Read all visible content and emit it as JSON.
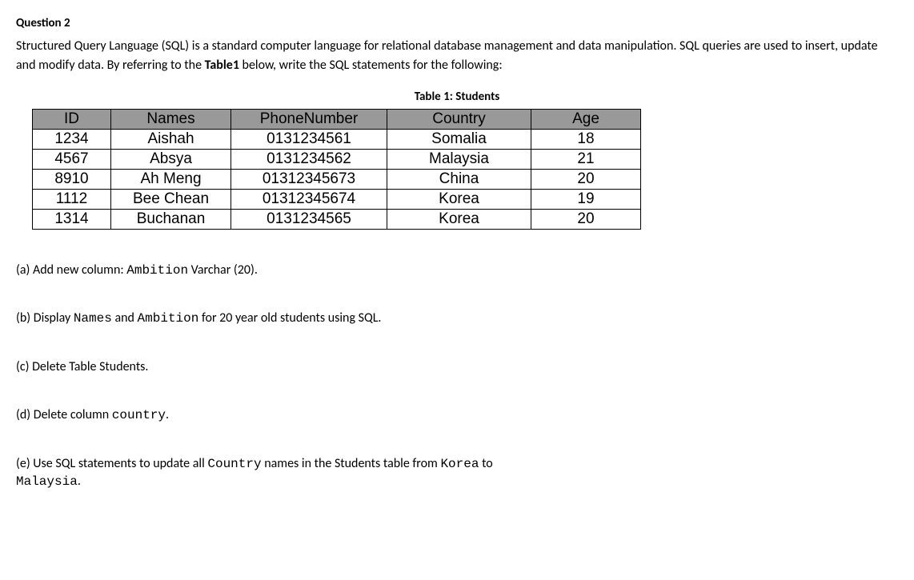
{
  "question_header": "Question 2",
  "intro_part1": "Structured Query Language (SQL) is a standard computer language for relational database management and data manipulation. SQL queries are used to insert, update and modify data. By referring to the ",
  "intro_bold": "Table1",
  "intro_part2": " below, write the SQL statements for the following:",
  "table_caption": "Table 1: Students",
  "table": {
    "headers": {
      "id": "ID",
      "names": "Names",
      "phone": "PhoneNumber",
      "country": "Country",
      "age": "Age"
    },
    "rows": [
      {
        "id": "1234",
        "names": "Aishah",
        "phone": "0131234561",
        "country": "Somalia",
        "age": "18"
      },
      {
        "id": "4567",
        "names": "Absya",
        "phone": "0131234562",
        "country": "Malaysia",
        "age": "21"
      },
      {
        "id": "8910",
        "names": "Ah Meng",
        "phone": "01312345673",
        "country": "China",
        "age": "20"
      },
      {
        "id": "1112",
        "names": "Bee Chean",
        "phone": "01312345674",
        "country": "Korea",
        "age": "19"
      },
      {
        "id": "1314",
        "names": "Buchanan",
        "phone": "0131234565",
        "country": "Korea",
        "age": "20"
      }
    ]
  },
  "sub_a": {
    "prefix": "(a) Add new column: ",
    "mono1": "Ambition",
    "suffix": " Varchar (20)."
  },
  "sub_b": {
    "prefix": "(b) Display ",
    "mono1": "Names",
    "mid1": " and ",
    "mono2": "Ambition",
    "suffix": " for 20 year old students using SQL."
  },
  "sub_c": {
    "text": "(c) Delete Table Students."
  },
  "sub_d": {
    "prefix": "(d) Delete column  ",
    "mono1": "country",
    "suffix": "."
  },
  "sub_e": {
    "prefix": "(e) Use SQL statements to update all ",
    "mono1": "Country",
    "mid1": " names in the Students  table from ",
    "mono2": "Korea",
    "mid2": " to ",
    "mono3": "Malaysia",
    "suffix": "."
  }
}
